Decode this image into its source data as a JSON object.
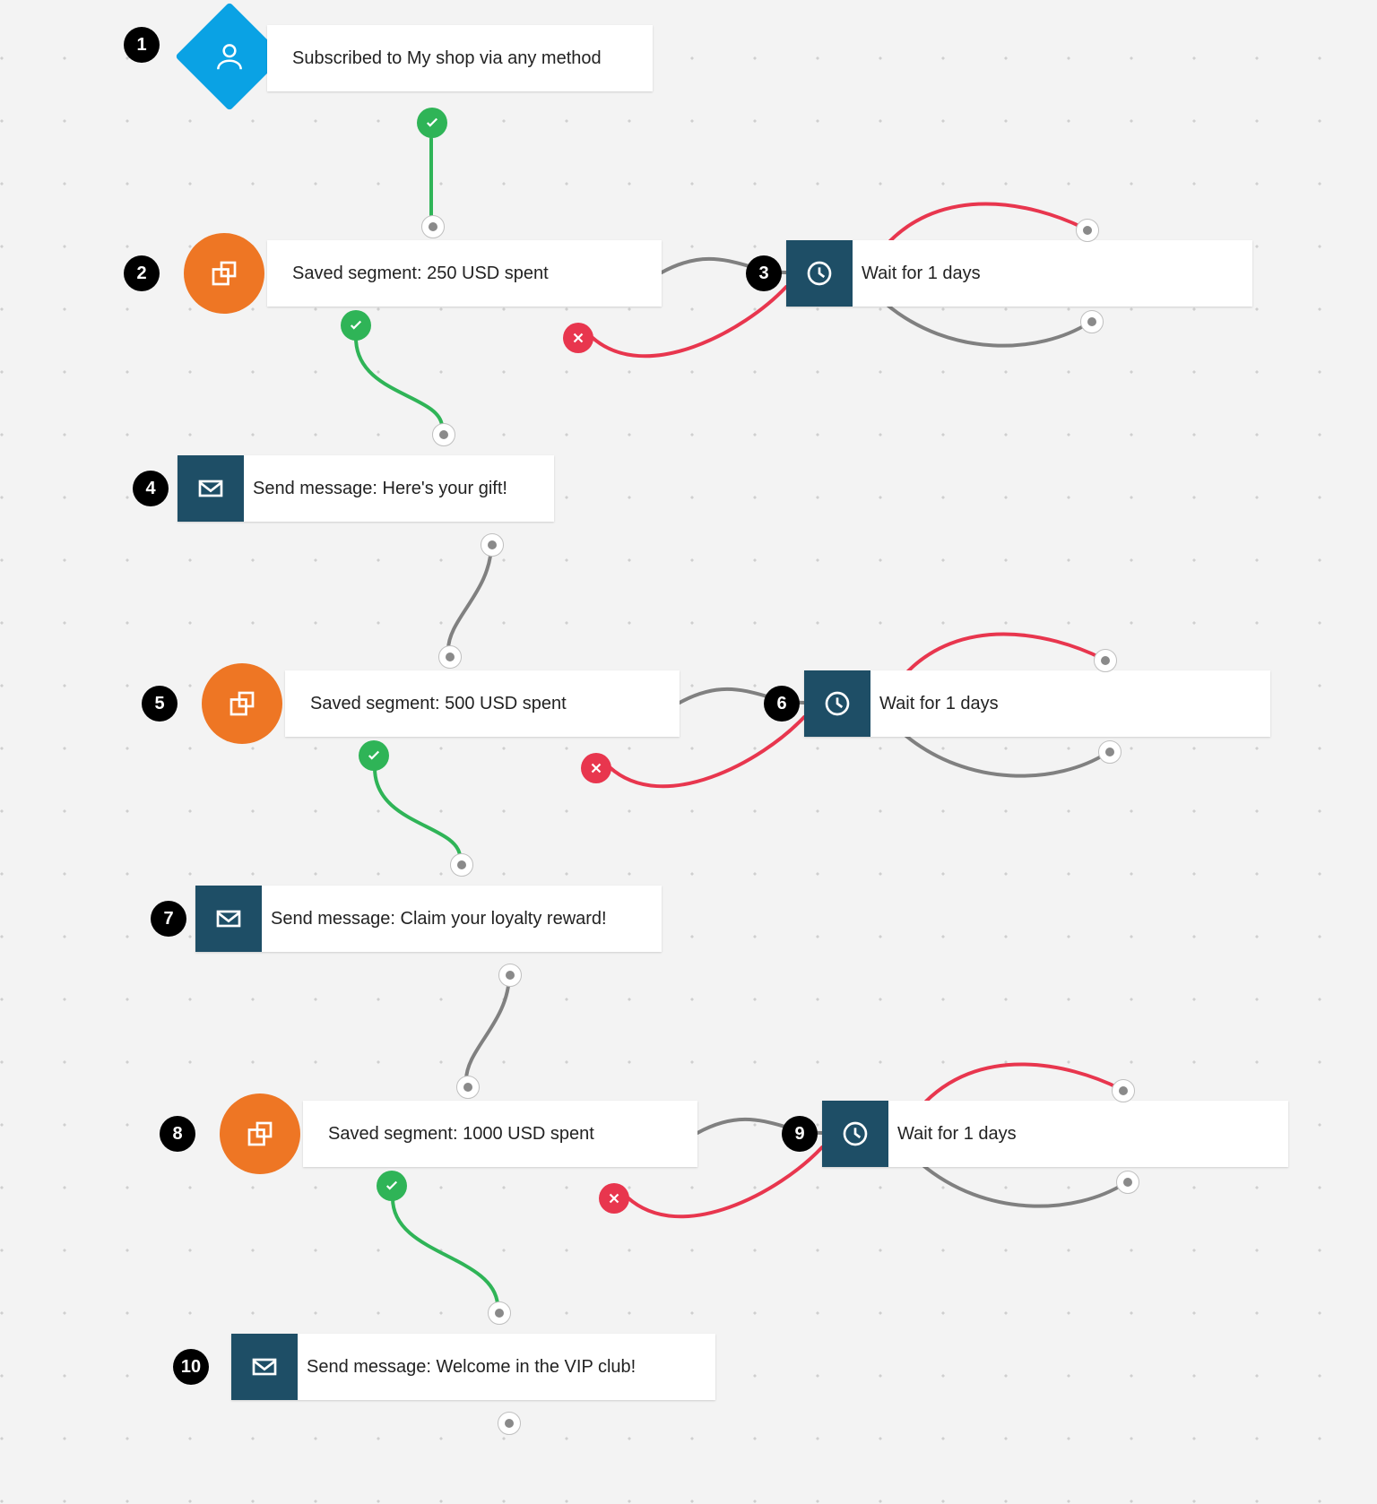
{
  "colors": {
    "diamond": "#0aa2e4",
    "circle": "#ee7624",
    "teal": "#1e4e66",
    "green": "#2fb457",
    "red": "#e8364e",
    "edge_gray": "#808080",
    "edge_green": "#2fb457",
    "edge_red": "#e8364e"
  },
  "nodes": {
    "n1": {
      "num": "1",
      "label": "Subscribed to My shop via any method"
    },
    "n2": {
      "num": "2",
      "label": "Saved segment: 250 USD spent"
    },
    "n3": {
      "num": "3",
      "label": "Wait for 1 days"
    },
    "n4": {
      "num": "4",
      "label": "Send message: Here's your gift!"
    },
    "n5": {
      "num": "5",
      "label": "Saved segment: 500 USD spent"
    },
    "n6": {
      "num": "6",
      "label": "Wait for 1 days"
    },
    "n7": {
      "num": "7",
      "label": "Send message: Claim your loyalty reward!"
    },
    "n8": {
      "num": "8",
      "label": "Saved segment: 1000 USD spent"
    },
    "n9": {
      "num": "9",
      "label": "Wait for 1 days"
    },
    "n10": {
      "num": "10",
      "label": "Send message: Welcome in the VIP club!"
    }
  }
}
